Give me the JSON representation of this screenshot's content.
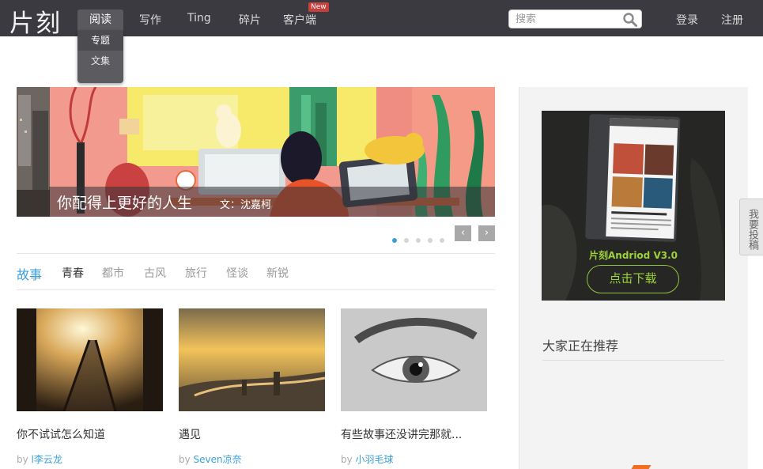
{
  "header": {
    "logo": "片刻",
    "nav": {
      "read": "阅读",
      "write": "写作",
      "ting": "Ting",
      "fragments": "碎片",
      "client": "客户端"
    },
    "new_badge": "New",
    "dropdown": {
      "topics": "专题",
      "collections": "文集"
    },
    "search": {
      "placeholder": "搜索",
      "value": ""
    },
    "login": "登录",
    "register": "注册"
  },
  "banner": {
    "title": "你配得上更好的人生",
    "author": "文：沈嘉柯",
    "slide_count": 5,
    "active_slide": 1,
    "prev": "‹",
    "next": "›"
  },
  "categories": [
    "故事",
    "青春",
    "都市",
    "古风",
    "旅行",
    "怪谈",
    "新锐"
  ],
  "articles": [
    {
      "title": "你不试试怎么知道",
      "by": "by",
      "author": "l李云龙"
    },
    {
      "title": "遇见",
      "by": "by",
      "author": "Seven凉奈"
    },
    {
      "title": "有些故事还没讲完那就...",
      "by": "by",
      "author": "小羽毛球"
    }
  ],
  "sidebar": {
    "ad_title": "片刻Andriod V3.0",
    "ad_button": "点击下载",
    "recommend_title": "大家正在推荐",
    "submit_tab": "我要投稿"
  },
  "colors": {
    "topbar": "#3a3a40",
    "accent_blue": "#3a9fd9",
    "ad_green": "#9ed23a",
    "new_badge": "#c8403c"
  }
}
